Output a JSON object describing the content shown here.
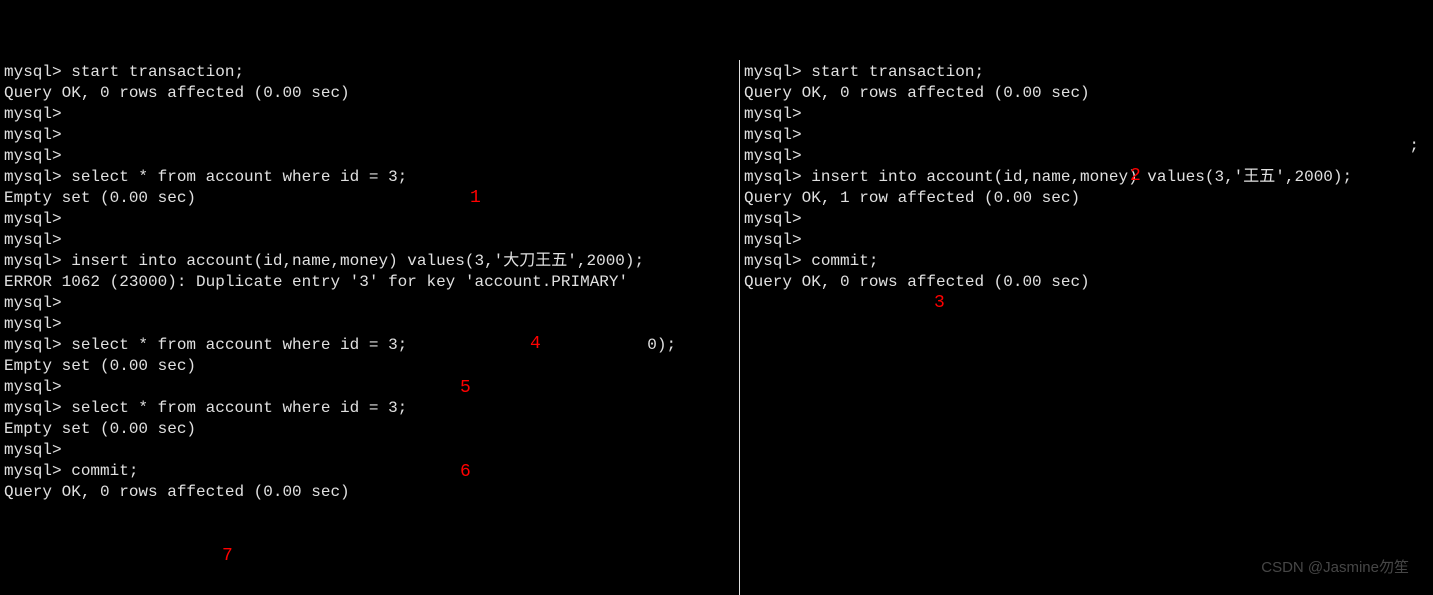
{
  "left_pane": {
    "lines": [
      "mysql> start transaction;",
      "Query OK, 0 rows affected (0.00 sec)",
      "",
      "mysql>",
      "mysql>",
      "mysql>",
      "mysql> select * from account where id = 3;",
      "Empty set (0.00 sec)",
      "",
      "mysql>",
      "mysql>",
      "mysql> insert into account(id,name,money) values(3,'大刀王五',2000);",
      "ERROR 1062 (23000): Duplicate entry '3' for key 'account.PRIMARY'",
      "mysql>",
      "mysql>",
      "mysql> select * from account where id = 3;                         0);",
      "Empty set (0.00 sec)",
      "",
      "mysql>",
      "mysql> select * from account where id = 3;",
      "Empty set (0.00 sec)",
      "",
      "mysql>",
      "mysql> commit;",
      "Query OK, 0 rows affected (0.00 sec)"
    ]
  },
  "right_pane": {
    "lines": [
      "mysql> start transaction;",
      "Query OK, 0 rows affected (0.00 sec)",
      "",
      "mysql>",
      "mysql>",
      "mysql>",
      "mysql> insert into account(id,name,money) values(3,'王五',2000);",
      "Query OK, 1 row affected (0.00 sec)",
      "",
      "mysql>",
      "mysql>",
      "mysql> commit;",
      "Query OK, 0 rows affected (0.00 sec)"
    ],
    "extra_semicolon": ";"
  },
  "annotations": {
    "a1": "1",
    "a2": "2",
    "a3": "3",
    "a4": "4",
    "a5": "5",
    "a6": "6",
    "a7": "7"
  },
  "watermark": "CSDN @Jasmine勿笙"
}
